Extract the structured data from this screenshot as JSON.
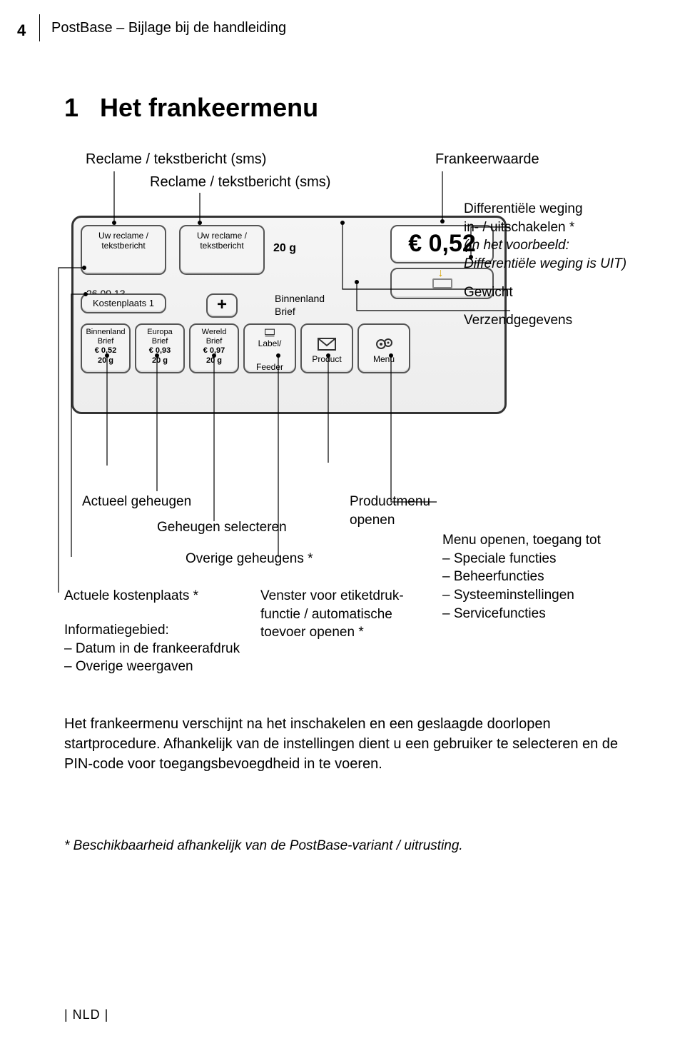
{
  "page_number": "4",
  "header": "PostBase – Bijlage bij de handleiding",
  "section_number": "1",
  "section_title": "Het frankeermenu",
  "top_labels": {
    "left": "Reclame / tekstbericht (sms)",
    "right": "Frankeerwaarde",
    "mid": "Reclame / tekstbericht (sms)"
  },
  "screen": {
    "ad1_l1": "Uw reclame /",
    "ad1_l2": "tekstbericht",
    "ad2_l1": "Uw reclame /",
    "ad2_l2": "tekstbericht",
    "date": "26.09.13",
    "kp": "Kostenplaats 1",
    "plus": "+",
    "weight": "20 g",
    "binnen_l1": "Binnenland",
    "binnen_l2": "Brief",
    "value": "€ 0,52",
    "mem1": {
      "l1": "Binnenland",
      "l2": "Brief",
      "l3": "€ 0,52",
      "l4": "20 g"
    },
    "mem2": {
      "l1": "Europa",
      "l2": "Brief",
      "l3": "€ 0,93",
      "l4": "20 g"
    },
    "mem3": {
      "l1": "Wereld",
      "l2": "Brief",
      "l3": "€ 0,97",
      "l4": "20 g"
    },
    "label_feeder_l1": "Label/",
    "label_feeder_l2": "Feeder",
    "product": "Product",
    "menu": "Menu"
  },
  "right_legend": {
    "diff1": "Differentiële weging",
    "diff2": "in- / uitschakelen *",
    "diff3": "(In het voorbeeld:",
    "diff4": "Differentiële weging is UIT)",
    "gewicht": "Gewicht",
    "verzend": "Verzendgegevens"
  },
  "lower": {
    "actueel_geheugen": "Actueel geheugen",
    "geheugen_selecteren": "Geheugen selecteren",
    "overige_geheugens": "Overige geheugens *",
    "actuele_kp": "Actuele kostenplaats *",
    "info_head": "Informatiegebied:",
    "info_items": [
      "Datum in de frankeerafdruk",
      "Overige weergaven"
    ],
    "venster_l1": "Venster voor etiketdruk-",
    "venster_l2": "functie / automatische",
    "venster_l3": "toevoer openen *",
    "productmenu_l1": "Productmenu",
    "productmenu_l2": "openen",
    "menu_open": "Menu openen, toegang tot",
    "menu_items": [
      "Speciale functies",
      "Beheerfuncties",
      "Systeeminstellingen",
      "Servicefuncties"
    ]
  },
  "body_p1": "Het frankeermenu verschijnt na het inschakelen en een geslaagde doorlopen startprocedure. Afhankelijk van de instellingen dient u een gebruiker te selecteren en de PIN-code voor toegangsbevoegdheid in te voeren.",
  "footnote": "*  Beschikbaarheid afhankelijk van de PostBase-variant / uitrusting.",
  "footer": "| NLD |"
}
